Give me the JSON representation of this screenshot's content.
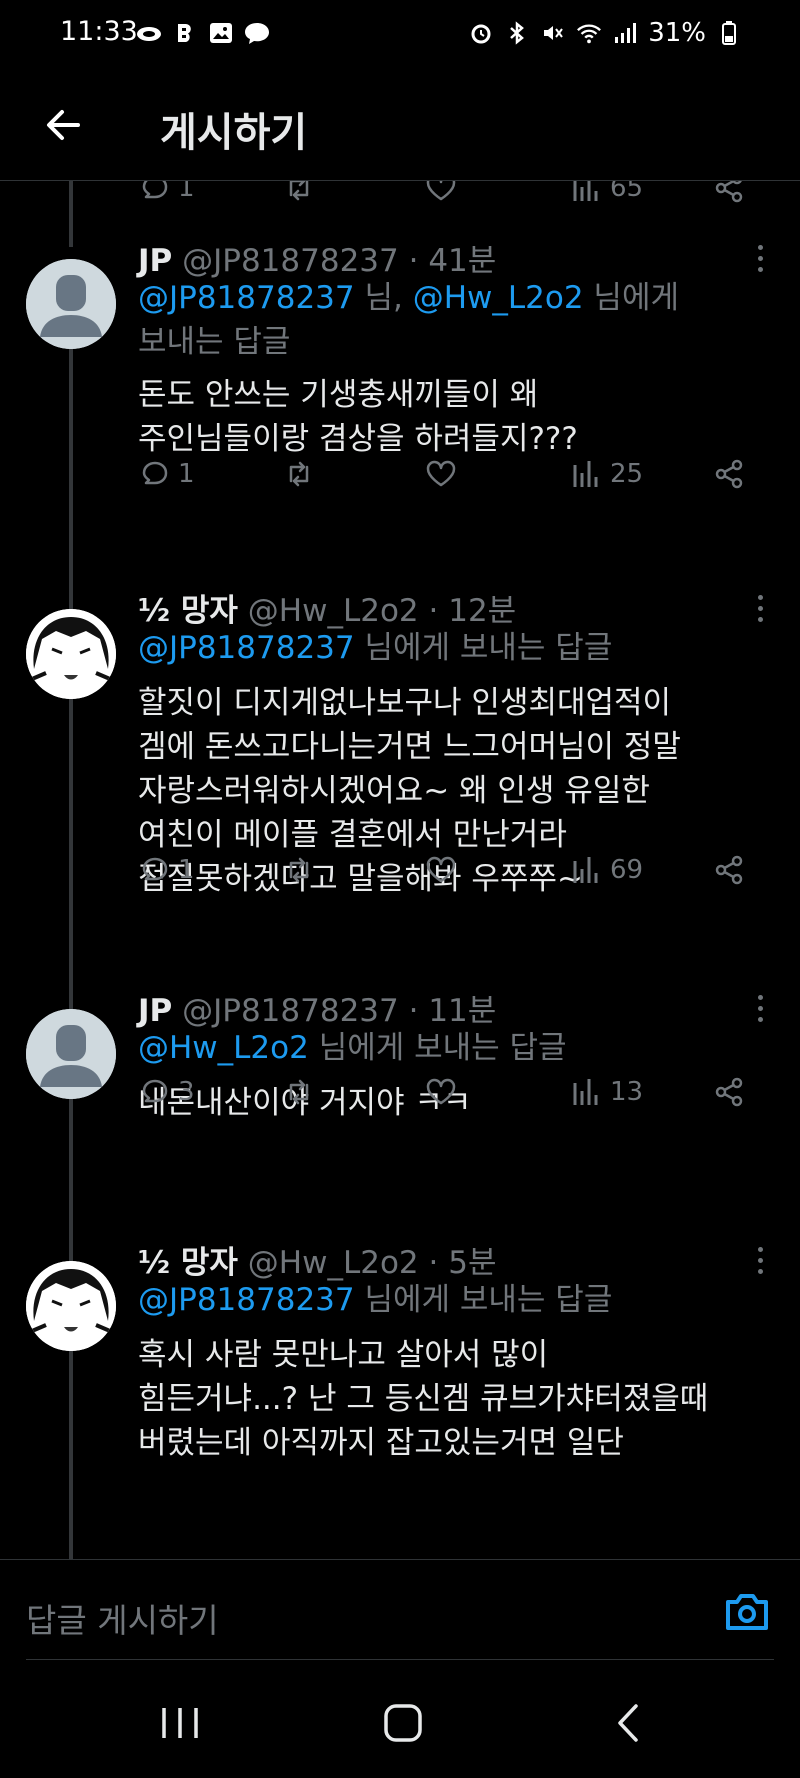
{
  "status": {
    "time": "11:33",
    "battery": "31%",
    "left_icons": [
      "cloud-icon",
      "b-icon",
      "gallery-icon",
      "bubble-icon"
    ],
    "right_icons": [
      "alarm-icon",
      "bluetooth-icon",
      "mute-icon",
      "wifi-icon",
      "signal-icon",
      "battery-icon"
    ]
  },
  "header": {
    "title": "게시하기",
    "back_icon": "back-arrow-icon"
  },
  "partial_actions": {
    "reply": "1",
    "views": "65"
  },
  "tweets": [
    {
      "name": "JP",
      "handle": "@JP81878237",
      "time": "41분",
      "reply_prefix": "",
      "reply_mentions": [
        "@JP81878237",
        "@Hw_L2o2"
      ],
      "reply_mid": " 님, ",
      "reply_suffix": " 님에게",
      "reply_suffix2": "보내는 답글",
      "body": "돈도 안쓰는 기생충새끼들이 왜\n주인님들이랑 겸상을 하려들지???",
      "replies": "1",
      "views": "25"
    },
    {
      "name": "½ 망자",
      "handle": "@Hw_L2o2",
      "time": "12분",
      "reply_mention": "@JP81878237",
      "reply_suffix": " 님에게 보내는 답글",
      "body": "할짓이 디지게없나보구나 인생최대업적이\n겜에 돈쓰고다니는거면 느그어머님이 정말\n자랑스러워하시겠어요~ 왜 인생 유일한\n여친이 메이플 결혼에서 만난거라\n접질못하겠다고 말을해봐 우쭈쭈~",
      "replies": "1",
      "views": "69"
    },
    {
      "name": "JP",
      "handle": "@JP81878237",
      "time": "11분",
      "reply_mention": "@Hw_L2o2",
      "reply_suffix": " 님에게 보내는 답글",
      "body": "내돈내산이야 거지야 ㅋㅋ",
      "replies": "3",
      "views": "13"
    },
    {
      "name": "½ 망자",
      "handle": "@Hw_L2o2",
      "time": "5분",
      "reply_mention": "@JP81878237",
      "reply_suffix": " 님에게 보내는 답글",
      "body": "혹시 사람 못만나고 살아서 많이\n힘든거냐...? 난 그 등신겜 큐브가챠터졌을때\n버렸는데 아직까지 잡고있는거면 일단"
    }
  ],
  "dot_sep": " · ",
  "composer": {
    "placeholder": "답글 게시하기",
    "camera_icon": "camera-icon"
  },
  "nav": [
    "recent-apps-icon",
    "home-icon",
    "back-icon"
  ],
  "colors": {
    "background": "#000000",
    "accent": "#1d9bf0",
    "muted": "#71767b",
    "text": "#e7e9ea"
  }
}
